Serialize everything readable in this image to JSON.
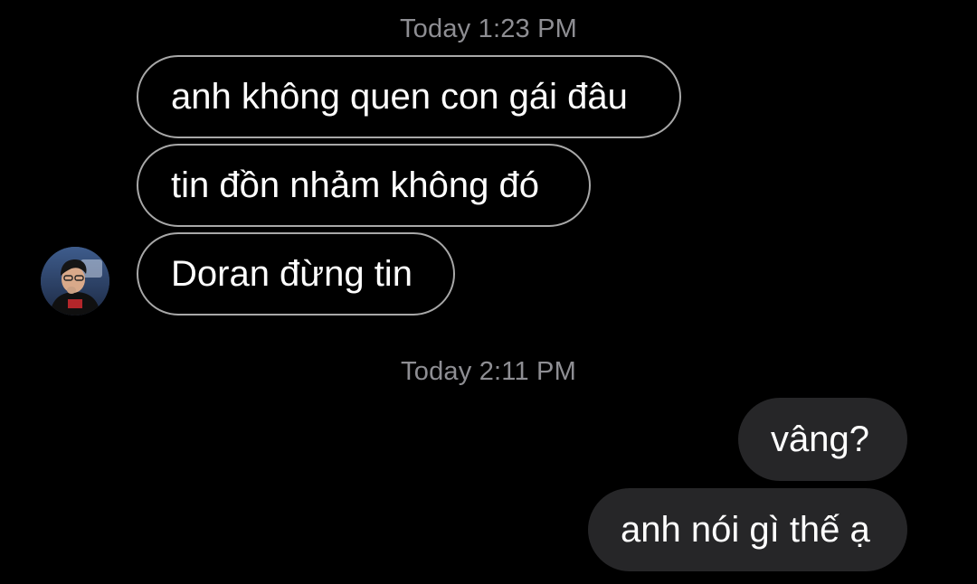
{
  "conversation": {
    "groups": [
      {
        "timestamp": "Today 1:23 PM",
        "messages": [
          {
            "text": "anh không quen con gái đâu",
            "direction": "incoming"
          },
          {
            "text": "tin đồn nhảm không đó",
            "direction": "incoming"
          },
          {
            "text": "Doran đừng tin",
            "direction": "incoming"
          }
        ]
      },
      {
        "timestamp": "Today 2:11 PM",
        "messages": [
          {
            "text": "vâng?",
            "direction": "outgoing"
          },
          {
            "text": "anh nói gì thế ạ",
            "direction": "outgoing"
          }
        ]
      }
    ]
  },
  "colors": {
    "background": "#000000",
    "timestamp": "#8e8e93",
    "incoming_border": "#a8a8a8",
    "outgoing_bubble": "#262628",
    "text": "#ffffff"
  },
  "icons": {
    "avatar": "profile-photo-avatar"
  }
}
